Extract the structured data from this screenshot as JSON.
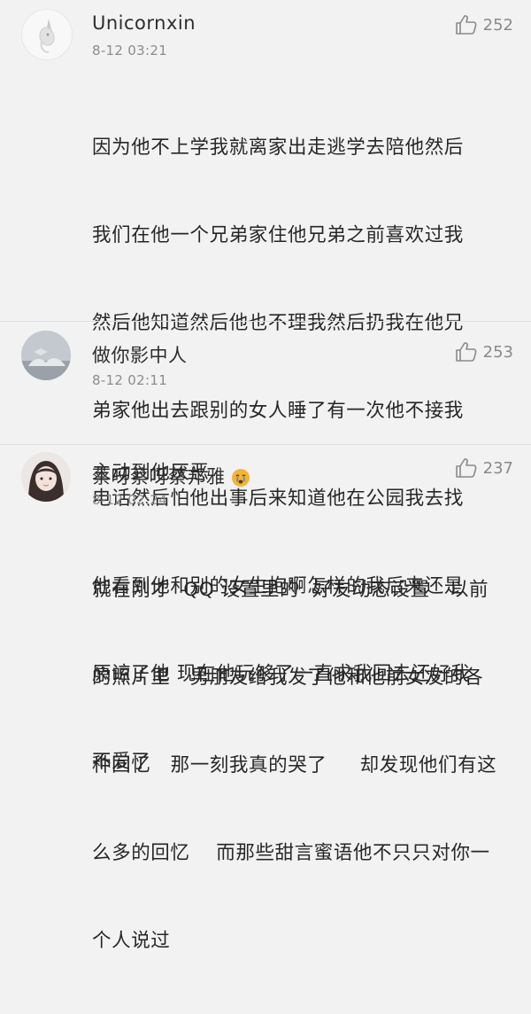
{
  "comments": [
    {
      "username": "Unicornxin",
      "timestamp": "8-12 03:21",
      "likes": "252",
      "lines": [
        "因为他不上学我就离家出走逃学去陪他然后",
        "我们在他一个兄弟家住他兄弟之前喜欢过我",
        "然后他知道然后他也不理我然后扔我在他兄",
        "弟家他出去跟别的女人睡了有一次他不接我",
        "电话然后怕他出事后来知道他在公园我去找",
        "他看到他和别的女生抱啊怎样的我后来还是",
        "原谅了他 现在他玩够了一直求我回去还好我",
        "不爱了"
      ]
    },
    {
      "username": "做你影中人",
      "timestamp": "8-12 02:11",
      "likes": "253",
      "lines": [
        "主动到他厌恶"
      ]
    },
    {
      "username": "蔡呀蔡呀蔡邦雅",
      "timestamp": "8-12 02:24",
      "likes": "237",
      "lines": [
        "就在刚才  QQ 设置里的  好友动态设置   以前",
        "的照片里   男朋友给我发了他和他前女友的各",
        "种回忆   那一刻我真的哭了     却发现他们有这",
        "么多的回忆    而那些甜言蜜语他不只只对你一",
        "个人说过"
      ]
    }
  ],
  "icons": {
    "like": "thumbs-up-outline-icon",
    "badge": "crying-emoji-icon"
  },
  "colors": {
    "background": "#f2f2f2",
    "text": "#272727",
    "meta": "#8c8c8c",
    "divider": "#dedede",
    "badge": "#f3b335"
  }
}
